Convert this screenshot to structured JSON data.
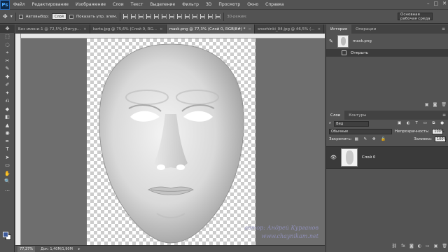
{
  "app": {
    "logo": "Ps"
  },
  "menu": [
    "Файл",
    "Редактирование",
    "Изображение",
    "Слои",
    "Текст",
    "Выделение",
    "Фильтр",
    "3D",
    "Просмотр",
    "Окно",
    "Справка"
  ],
  "window_controls": {
    "minimize": "–",
    "maximize": "□",
    "close": "✕"
  },
  "options": {
    "auto_select_label": "Автовыбор:",
    "auto_select_value": "Слой",
    "show_controls_label": "Показать упр. элем.",
    "mode_3d_label": "3D-режим:",
    "workspace": "Основная рабочая среда"
  },
  "tabs": [
    {
      "label": "Без имени-1 @ 72,5% (Фигур...",
      "active": false
    },
    {
      "label": "karta.jpg @ 75,6% (Слой 0, RG...",
      "active": false
    },
    {
      "label": "mask.png @ 77,3% (Слой 0, RGB/8#) *",
      "active": true
    },
    {
      "label": "snezhinki_04.jpg @ 46,5% (...",
      "active": false
    }
  ],
  "tools": [
    "✥",
    "⬚",
    "◌",
    "⌖",
    "✂",
    "✎",
    "✚",
    "✐",
    "✦",
    "⎌",
    "◆",
    "◧",
    "▲",
    "◉",
    "✒",
    "T",
    "➤",
    "▭",
    "✋",
    "🔍",
    "…"
  ],
  "status": {
    "zoom": "77,27%",
    "doc": "Док: 1,40M/1,90M"
  },
  "watermark": {
    "line1": "автор: Андрей Курганов",
    "line2": "www.chaynikam.net"
  },
  "history_panel": {
    "tabs": [
      "История",
      "Операции"
    ],
    "snapshot": "mask.png",
    "steps": [
      "Открыть"
    ]
  },
  "layers_panel": {
    "tabs": [
      "Слои",
      "Контуры"
    ],
    "filter": "Вид",
    "blend_mode": "Обычные",
    "opacity_label": "Непрозрачность:",
    "opacity": "100%",
    "lock_label": "Закрепить:",
    "fill_label": "Заливка:",
    "fill": "100%",
    "layers": [
      {
        "name": "Слой 0",
        "visible": true
      }
    ]
  },
  "colors": {
    "accent_fg": "#3d5a9a",
    "accent_bg": "#ffffff",
    "ui_dark": "#535353",
    "canvas_gray": "#6e6e6e"
  }
}
